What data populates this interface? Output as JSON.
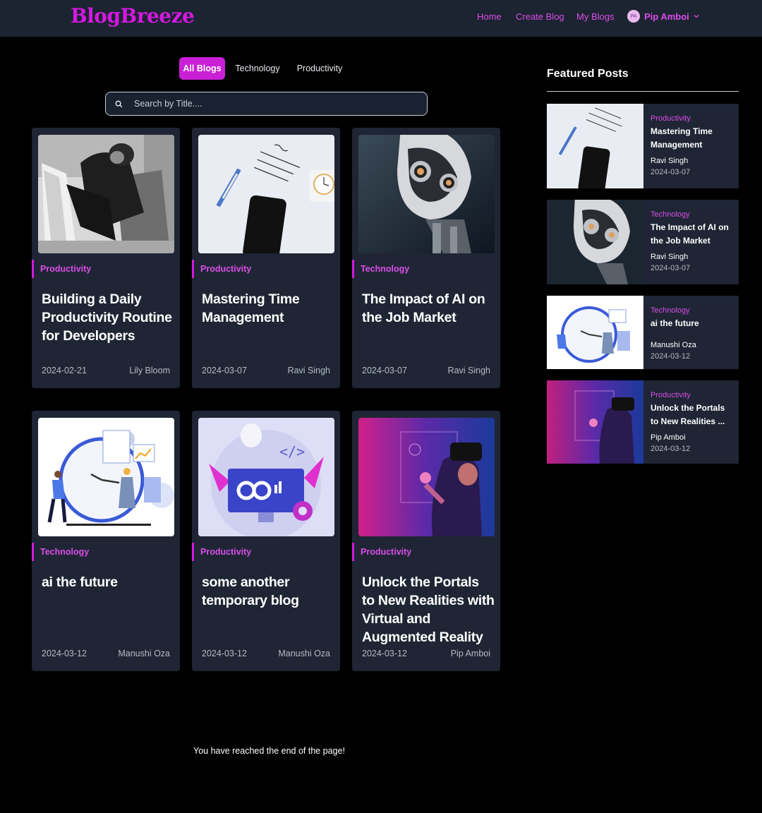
{
  "header": {
    "logo": "BlogBreeze",
    "nav": {
      "home": "Home",
      "create": "Create Blog",
      "my_blogs": "My Blogs"
    },
    "user": {
      "initials": "PA",
      "name": "Pip Amboi"
    }
  },
  "filters": {
    "all": "All Blogs",
    "technology": "Technology",
    "productivity": "Productivity",
    "active": "All Blogs"
  },
  "search": {
    "placeholder": "Search by Title...."
  },
  "cards": [
    {
      "category": "Productivity",
      "title": "Building a Daily Productivity Routine for Developers",
      "date": "2024-02-21",
      "author": "Lily Bloom",
      "image": "person-sleeping-photo"
    },
    {
      "category": "Productivity",
      "title": "Mastering Time Management",
      "date": "2024-03-07",
      "author": "Ravi Singh",
      "image": "todo-note-phone-photo"
    },
    {
      "category": "Technology",
      "title": "The Impact of AI on the Job Market",
      "date": "2024-03-07",
      "author": "Ravi Singh",
      "image": "robot-photo"
    },
    {
      "category": "Technology",
      "title": "ai the future",
      "date": "2024-03-12",
      "author": "Manushi Oza",
      "image": "clock-illustration"
    },
    {
      "category": "Productivity",
      "title": "some another temporary blog",
      "date": "2024-03-12",
      "author": "Manushi Oza",
      "image": "coding-monitor-illustration"
    },
    {
      "category": "Productivity",
      "title": "Unlock the Portals to New Realities with Virtual and Augmented Reality",
      "date": "2024-03-12",
      "author": "Pip Amboi",
      "image": "vr-headset-photo"
    }
  ],
  "featured": {
    "heading": "Featured Posts",
    "items": [
      {
        "category": "Productivity",
        "title": "Mastering Time Management",
        "author": "Ravi Singh",
        "date": "2024-03-07"
      },
      {
        "category": "Technology",
        "title": "The Impact of AI on the Job Market",
        "author": "Ravi Singh",
        "date": "2024-03-07"
      },
      {
        "category": "Technology",
        "title": "ai the future",
        "author": "Manushi Oza",
        "date": "2024-03-12"
      },
      {
        "category": "Productivity",
        "title": "Unlock the Portals to New Realities ...",
        "author": "Pip Amboi",
        "date": "2024-03-12"
      }
    ]
  },
  "footer": {
    "end_message": "You have reached the end of the page!"
  },
  "colors": {
    "accent": "#d419e0",
    "header_bg": "#1c2331",
    "card_bg": "#1f2534",
    "page_bg": "#000000"
  }
}
